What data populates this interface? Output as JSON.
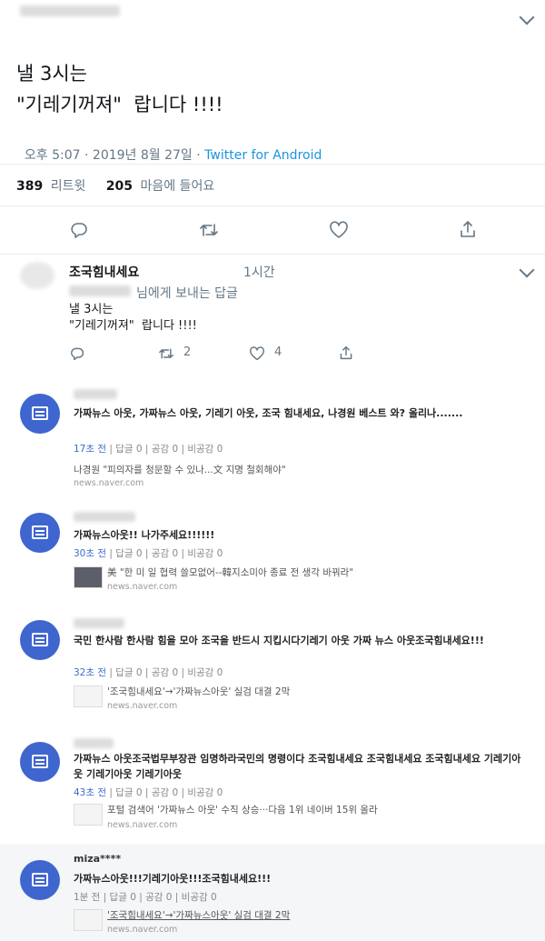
{
  "tweet": {
    "line1": "낼 3시는",
    "line2": "\"기레기꺼져\"  랍니다 !!!!",
    "time": "오후 5:07 · 2019년 8월 27일 · ",
    "source": "Twitter for Android",
    "retweet_count": "389",
    "retweet_label": "리트윗",
    "like_count": "205",
    "like_label": "마음에 들어요"
  },
  "reply": {
    "name": "조국힘내세요",
    "time": "1시간",
    "replying_to": "님에게 보내는 답글",
    "line1": "낼 3시는",
    "line2": "\"기레기꺼져\"  랍니다 !!!!",
    "retweets": "2",
    "likes": "4"
  },
  "comments": [
    {
      "author": "",
      "text": "가짜뉴스 아웃, 가짜뉴스 아웃, 기레기 아웃, 조국 힘내세요, 나경원 베스트 와? 올리나.......",
      "time": "17초 전",
      "stats": " | 답글 0 | 공감 0 | 비공감 0",
      "link_title": "나경원 \"피의자를 청문할 수 있나...文 지명 철회해야\"",
      "link_host": "news.naver.com"
    },
    {
      "author": "",
      "text": "가짜뉴스아웃!! 나가주세요!!!!!!",
      "time": "30초 전",
      "stats": " | 답글 0 | 공감 0 | 비공감 0",
      "link_title": "美 \"한 미 일 협력 쓸모없어--韓지소미아 종료 전 생각 바꿔라\"",
      "link_host": "news.naver.com"
    },
    {
      "author": "",
      "text": "국민 한사람 한사람 힘을 모아 조국을 반드시 지킵시다기레기 아웃 가짜 뉴스 아웃조국힘내세요!!!",
      "time": "32초 전",
      "stats": " | 답글 0 | 공감 0 | 비공감 0",
      "link_title": "'조국힘내세요'→'가짜뉴스아웃' 실검 대결 2막",
      "link_host": "news.naver.com"
    },
    {
      "author": "",
      "text": "가짜뉴스 아웃조국법무부장관 임명하라국민의 명령이다 조국힘내세요 조국힘내세요 조국힘내세요 기레기아웃 기레기아웃 기레기아웃",
      "time": "43초 전",
      "stats": " | 답글 0 | 공감 0 | 비공감 0",
      "link_title": "포털 검색어 '가짜뉴스 아웃' 수직 상승···다음 1위 네이버 15위 올라",
      "link_host": "news.naver.com"
    },
    {
      "author": "miza****",
      "text": "가짜뉴스아웃!!!기레기아웃!!!조국힘내세요!!!",
      "time": "1분 전",
      "stats": " | 답글 0 | 공감 0 | 비공감 0",
      "link_title": "'조국힘내세요'→'가짜뉴스아웃' 실검 대결 2막",
      "link_host": "news.naver.com"
    }
  ]
}
